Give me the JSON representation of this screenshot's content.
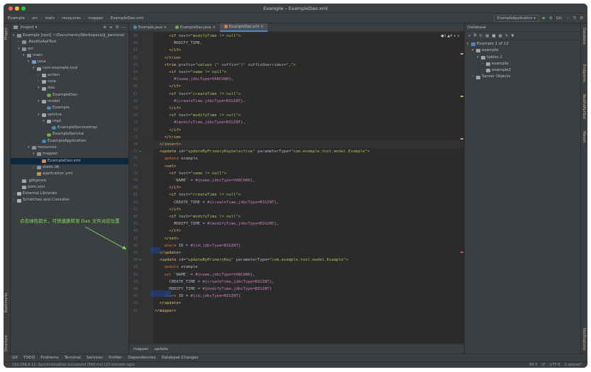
{
  "window": {
    "title": "Example – ExampleDao.xml"
  },
  "navbar": {
    "crumbs": [
      "Example",
      "src",
      "main",
      "resources",
      "mapper",
      "ExampleDao.xml"
    ],
    "run_config": "ExampleApplication ▾",
    "git_label": "Git:"
  },
  "project": {
    "title": "Project ▾",
    "tree": [
      {
        "label": "Example [tool]  ~/Documents/Workspace/jj_personal",
        "depth": 0,
        "arrow": "▾",
        "icon": "folder"
      },
      {
        "label": ".RestfulApiTool",
        "depth": 1,
        "arrow": "›",
        "icon": "folder"
      },
      {
        "label": "src",
        "depth": 1,
        "arrow": "▾",
        "icon": "folder"
      },
      {
        "label": "main",
        "depth": 2,
        "arrow": "▾",
        "icon": "folder"
      },
      {
        "label": "java",
        "depth": 3,
        "arrow": "▾",
        "icon": "jfolder"
      },
      {
        "label": "com.example.tool",
        "depth": 4,
        "arrow": "▾",
        "icon": "pkg"
      },
      {
        "label": "action",
        "depth": 5,
        "arrow": "›",
        "icon": "pkg"
      },
      {
        "label": "core",
        "depth": 5,
        "arrow": "›",
        "icon": "pkg"
      },
      {
        "label": "dao",
        "depth": 5,
        "arrow": "▾",
        "icon": "pkg"
      },
      {
        "label": "ExampleDao",
        "depth": 6,
        "arrow": "",
        "icon": "iface"
      },
      {
        "label": "model",
        "depth": 5,
        "arrow": "▾",
        "icon": "pkg"
      },
      {
        "label": "Example",
        "depth": 6,
        "arrow": "",
        "icon": "class"
      },
      {
        "label": "service",
        "depth": 5,
        "arrow": "▾",
        "icon": "pkg"
      },
      {
        "label": "impl",
        "depth": 6,
        "arrow": "▾",
        "icon": "pkg"
      },
      {
        "label": "ExampleServiceImpl",
        "depth": 7,
        "arrow": "",
        "icon": "class"
      },
      {
        "label": "ExampleService",
        "depth": 6,
        "arrow": "",
        "icon": "iface"
      },
      {
        "label": "ExampleApplication",
        "depth": 5,
        "arrow": "",
        "icon": "class"
      },
      {
        "label": "resources",
        "depth": 3,
        "arrow": "▾",
        "icon": "folder"
      },
      {
        "label": "mapper",
        "depth": 4,
        "arrow": "▾",
        "icon": "folder"
      },
      {
        "label": "ExampleDao.xml",
        "depth": 5,
        "arrow": "",
        "icon": "xml",
        "selected": true
      },
      {
        "label": "static.lib",
        "depth": 4,
        "arrow": "›",
        "icon": "folder"
      },
      {
        "label": "application.yml",
        "depth": 4,
        "arrow": "",
        "icon": "yml"
      },
      {
        "label": ".gitignore",
        "depth": 1,
        "arrow": "",
        "icon": "file"
      },
      {
        "label": "pom.xml",
        "depth": 1,
        "arrow": "",
        "icon": "file"
      },
      {
        "label": "External Libraries",
        "depth": 0,
        "arrow": "›",
        "icon": "lib"
      },
      {
        "label": "Scratches and Consoles",
        "depth": 0,
        "arrow": "›",
        "icon": "lib"
      }
    ]
  },
  "editor": {
    "tabs": [
      {
        "label": "Example.java",
        "color": "#3592c4",
        "active": false
      },
      {
        "label": "ExampleDao.java",
        "color": "#62b543",
        "active": false
      },
      {
        "label": "ExampleDao.xml",
        "color": "#e0824f",
        "active": true
      }
    ],
    "inspections": "●1 ▲4 ∧ ∨",
    "lines": [
      {
        "n": "59",
        "code": "      <if test=\"modifyTime != null\">"
      },
      {
        "n": "60",
        "code": "        MODIFY_TIME,"
      },
      {
        "n": "61",
        "code": "      </if>"
      },
      {
        "n": "62",
        "code": "    </trim>"
      },
      {
        "n": "63",
        "code": "    <trim prefix=\"values (\" suffix=\")\" suffixOverrides=\",\">"
      },
      {
        "n": "64",
        "code": "      <if test=\"name != null\">"
      },
      {
        "n": "65",
        "code": "        #{name,jdbcType=VARCHAR},"
      },
      {
        "n": "66",
        "code": "      </if>"
      },
      {
        "n": "67",
        "code": "      <if test=\"createTime != null\">"
      },
      {
        "n": "68",
        "code": "        #{createTime,jdbcType=BIGINT},"
      },
      {
        "n": "69",
        "code": "      </if>"
      },
      {
        "n": "70",
        "code": "      <if test=\"modifyTime != null\">"
      },
      {
        "n": "71",
        "code": "        #{modifyTime,jdbcType=BIGINT},"
      },
      {
        "n": "72",
        "code": "      </if>"
      },
      {
        "n": "73",
        "code": "    </trim>"
      },
      {
        "n": "74",
        "code": "  </insert>"
      },
      {
        "n": "75",
        "code": "  <update id=\"updateByPrimaryKeySelective\" parameterType=\"com.example.tool.model.Example\">"
      },
      {
        "n": "76",
        "code": "    update example"
      },
      {
        "n": "77",
        "code": "    <set>"
      },
      {
        "n": "78",
        "code": "      <if test=\"name != null\">"
      },
      {
        "n": "79",
        "code": "        `NAME` = #{name,jdbcType=VARCHAR},"
      },
      {
        "n": "80",
        "code": "      </if>"
      },
      {
        "n": "81",
        "code": "      <if test=\"createTime != null\">"
      },
      {
        "n": "82",
        "code": "        CREATE_TIME = #{createTime,jdbcType=BIGINT},"
      },
      {
        "n": "83",
        "code": "      </if>"
      },
      {
        "n": "84",
        "code": "      <if test=\"modifyTime != null\">"
      },
      {
        "n": "85",
        "code": "        MODIFY_TIME = #{modifyTime,jdbcType=BIGINT},"
      },
      {
        "n": "86",
        "code": "      </if>"
      },
      {
        "n": "87",
        "code": "    </set>"
      },
      {
        "n": "88",
        "code": "    where ID = #{id,jdbcType=BIGINT}"
      },
      {
        "n": "89",
        "code": "  </update>"
      },
      {
        "n": "90",
        "code": "  <update id=\"updateByPrimaryKey\" parameterType=\"com.example.tool.model.Example\">"
      },
      {
        "n": "91",
        "code": "    update example"
      },
      {
        "n": "92",
        "code": "    set `NAME` = #{name,jdbcType=VARCHAR},"
      },
      {
        "n": "93",
        "code": "      CREATE_TIME = #{createTime,jdbcType=BIGINT},"
      },
      {
        "n": "94",
        "code": "      MODIFY_TIME = #{modifyTime,jdbcType=BIGINT}"
      },
      {
        "n": "95",
        "code": "    where ID = #{id,jdbcType=BIGINT}"
      },
      {
        "n": "96",
        "code": "  </update>"
      },
      {
        "n": "97",
        "code": "</mapper>"
      }
    ],
    "breadcrumb": [
      "mapper",
      "update"
    ]
  },
  "annotation": {
    "text": "点击绿色箭头，可快速跳转至 Dao 文件对应位置",
    "color": "#7ee05a"
  },
  "database": {
    "title": "Database",
    "tree": [
      {
        "label": "Example  1 of 12",
        "depth": 0,
        "arrow": "▾"
      },
      {
        "label": "example",
        "depth": 1,
        "arrow": "▾"
      },
      {
        "label": "tables  2",
        "depth": 2,
        "arrow": "▾"
      },
      {
        "label": "example",
        "depth": 3,
        "arrow": "›"
      },
      {
        "label": "example2",
        "depth": 3,
        "arrow": "›"
      },
      {
        "label": "Server Objects",
        "depth": 1,
        "arrow": "›"
      }
    ]
  },
  "left_strip": [
    "Project",
    "Bookmarks",
    "Structure"
  ],
  "right_strip": [
    "Database",
    "Endpoints",
    "RestfulApiTool",
    "Maven",
    "Notifications"
  ],
  "bottom_tools": [
    "Git",
    "TODO",
    "Problems",
    "Terminal",
    "Services",
    "Profiler",
    "Dependencies",
    "Database Changes"
  ],
  "status": {
    "message": "192.168.8.11: Synchronization successful (566 ms) (23 minutes ago)",
    "right": [
      "89:3",
      "LF",
      "UTF-8",
      "2 spaces*"
    ]
  },
  "colors": {
    "accent": "#4a88c7",
    "annotation": "#7ee05a"
  }
}
